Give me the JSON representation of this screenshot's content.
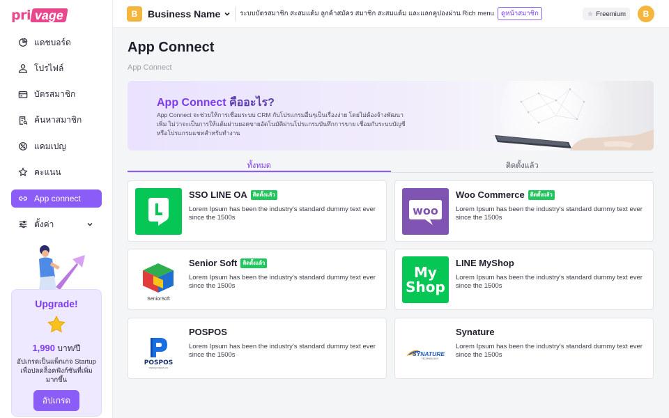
{
  "brand": {
    "logo_a": "pri",
    "logo_b": "vage"
  },
  "sidebar": {
    "items": [
      {
        "label": "แดชบอร์ด",
        "icon": "pie-chart-icon"
      },
      {
        "label": "โปรไฟล์",
        "icon": "user-icon"
      },
      {
        "label": "บัตรสมาชิก",
        "icon": "card-icon"
      },
      {
        "label": "ค้นหาสมาชิก",
        "icon": "search-document-icon"
      },
      {
        "label": "แคมเปญ",
        "icon": "campaign-icon"
      },
      {
        "label": "คะแนน",
        "icon": "star-icon"
      },
      {
        "label": "App connect",
        "icon": "link-icon",
        "active": true
      },
      {
        "label": "ตั้งค่า",
        "icon": "settings-sliders-icon"
      }
    ]
  },
  "upgrade": {
    "title": "Upgrade!",
    "price": "1,990",
    "price_unit": "บาท/ปี",
    "desc": "อัปเกรดเป็นแพ็กเกจ Startup เพื่อปลดล็อคฟังก์ชันที่เพิ่มมากขึ้น",
    "button": "อัปเกรด"
  },
  "topbar": {
    "avatar": "B",
    "business_name": "Business Name",
    "description": "ระบบบัตรสมาชิก สะสมแต้ม ลูกค้าสมัคร สมาชิก สะสมแต้ม และแลกคูปองผ่าน Rich menu",
    "link": "ดูหน้าสมาชิก",
    "plan": "Freemium",
    "user_avatar": "B"
  },
  "page": {
    "title": "App Connect",
    "breadcrumb": "App Connect"
  },
  "banner": {
    "title_a": "App Connect",
    "title_b": " คืออะไร?",
    "text": "App Connect จะช่วยให้การเชื่อมระบบ CRM กับโปรแกรมอื่นๆเป็นเรื่องง่าย โดยไม่ต้องจ้างพัฒนาเพิ่ม ไม่ว่าจะเป็นการให้แต้มผ่านยอดขายอัตโนมัติผ่านโปรแกรมบันทึกการขาย เชื่อมกับระบบบัญชี หรือโปรแกรมแชทสำหรับทำงาน"
  },
  "tabs": [
    {
      "label": "ทั้งหมด",
      "active": true
    },
    {
      "label": "ติดตั้งแล้ว",
      "active": false
    }
  ],
  "colors": {
    "accent": "#8b5cf6",
    "accent_text": "#7c3aed",
    "installed": "#22c55e",
    "brand": "#e8478b"
  },
  "apps": [
    {
      "name": "SSO LINE OA",
      "badge": "ติดตั้งแล้ว",
      "desc": "Lorem Ipsum has been the industry's standard dummy text ever since the 1500s",
      "logo": "line-logo"
    },
    {
      "name": "Woo Commerce",
      "badge": "ติดตั้งแล้ว",
      "desc": "Lorem Ipsum has been the industry's standard dummy text ever since the 1500s",
      "logo": "woo-logo"
    },
    {
      "name": "Senior Soft",
      "badge": "ติดตั้งแล้ว",
      "desc": "Lorem Ipsum has been the industry's standard dummy text ever since the 1500s",
      "logo": "seniorsoft-logo",
      "logo_text": "SeniorSoft"
    },
    {
      "name": "LINE MyShop",
      "badge": "",
      "desc": "Lorem Ipsum has been the industry's standard dummy text ever since the 1500s",
      "logo": "myshop-logo",
      "logo_text_a": "My",
      "logo_text_b": "Shop"
    },
    {
      "name": "POSPOS",
      "badge": "",
      "desc": "Lorem Ipsum has been the industry's standard dummy text ever since the 1500s",
      "logo": "pospos-logo",
      "logo_text": "POSPOS",
      "logo_sub": "www.pospos.co"
    },
    {
      "name": "Synature",
      "badge": "",
      "desc": "Lorem Ipsum has been the industry's standard dummy text ever since the 1500s",
      "logo": "synature-logo",
      "logo_text": "SYNATURE",
      "logo_sub": "TECHNOLOGY"
    }
  ]
}
